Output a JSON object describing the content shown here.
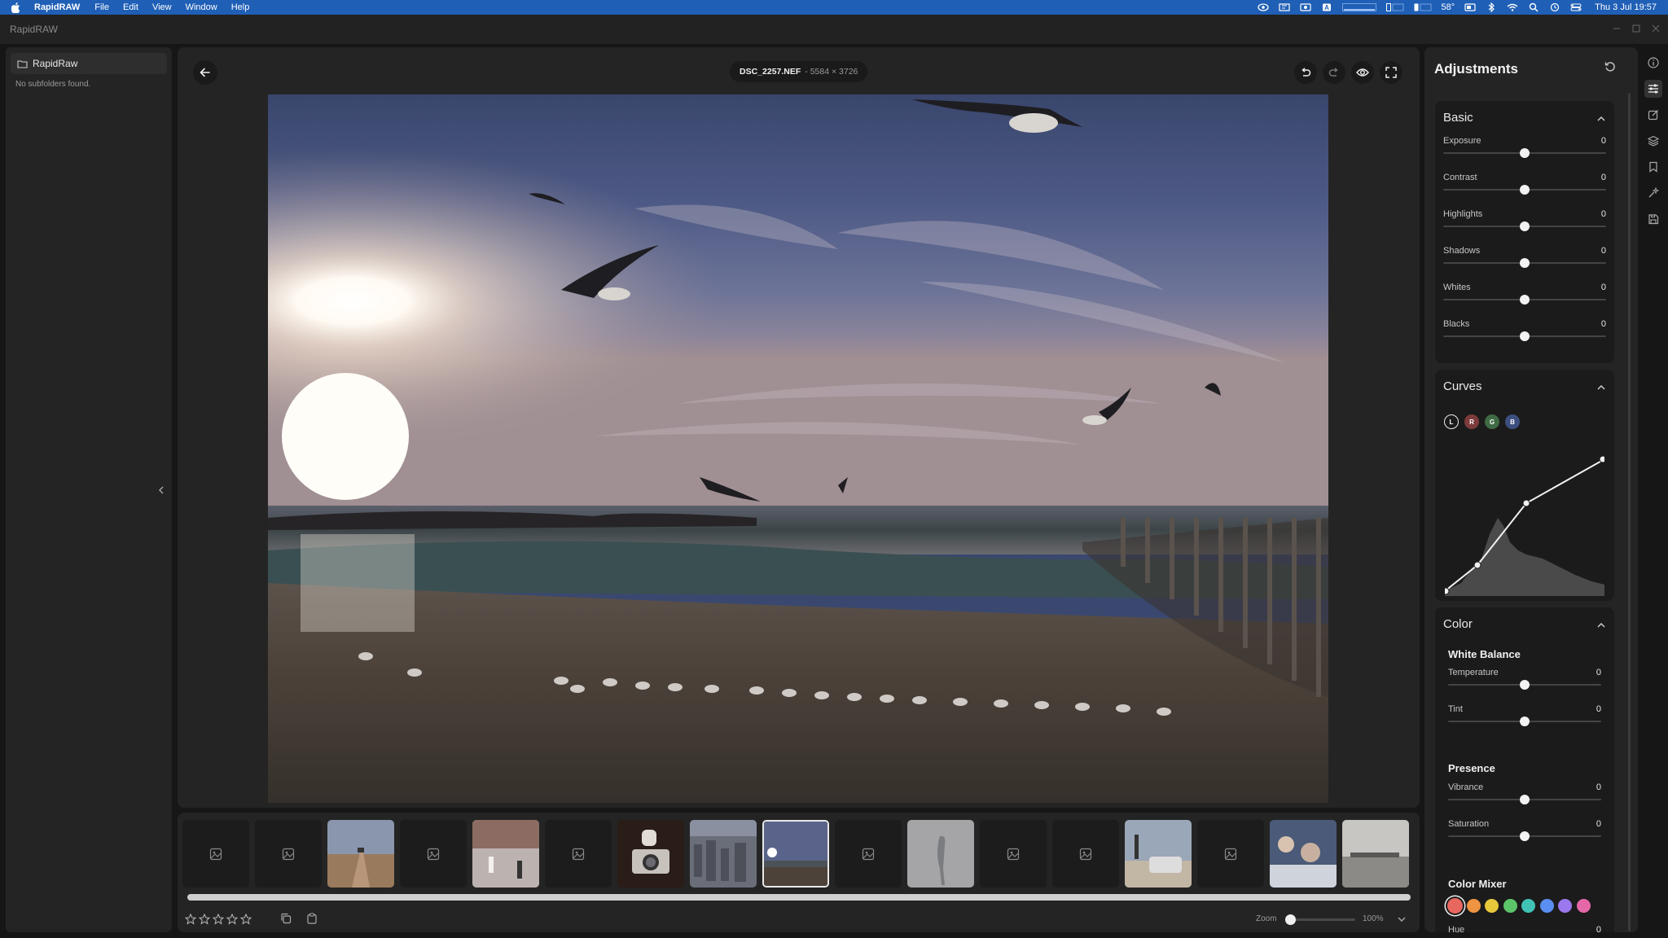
{
  "menubar": {
    "app_name": "RapidRAW",
    "menus": [
      "File",
      "Edit",
      "View",
      "Window",
      "Help"
    ],
    "temperature": "58°",
    "clock": "Thu 3 Jul  19:57"
  },
  "window": {
    "title": "RapidRAW"
  },
  "folders": {
    "root_label": "RapidRaw",
    "empty_message": "No subfolders found."
  },
  "editor": {
    "file_name": "DSC_2257.NEF",
    "dimensions": "- 5584 × 3726"
  },
  "filmstrip": {
    "zoom_label": "Zoom",
    "zoom_value": "100%",
    "zoom_fraction": 0.0,
    "rating_stars": 5
  },
  "adjustments": {
    "title": "Adjustments",
    "basic": {
      "title": "Basic",
      "sliders": [
        {
          "label": "Exposure",
          "value": "0"
        },
        {
          "label": "Contrast",
          "value": "0"
        },
        {
          "label": "Highlights",
          "value": "0"
        },
        {
          "label": "Shadows",
          "value": "0"
        },
        {
          "label": "Whites",
          "value": "0"
        },
        {
          "label": "Blacks",
          "value": "0"
        }
      ]
    },
    "curves": {
      "title": "Curves",
      "channels": [
        "L",
        "R",
        "G",
        "B"
      ]
    },
    "color": {
      "title": "Color",
      "white_balance": "White Balance",
      "wb_sliders": [
        {
          "label": "Temperature",
          "value": "0"
        },
        {
          "label": "Tint",
          "value": "0"
        }
      ],
      "presence": "Presence",
      "presence_sliders": [
        {
          "label": "Vibrance",
          "value": "0"
        },
        {
          "label": "Saturation",
          "value": "0"
        }
      ],
      "color_mixer": "Color Mixer",
      "swatches": [
        "#e8675f",
        "#ef9442",
        "#e7c83a",
        "#5cc56a",
        "#40c3b5",
        "#5a8ef0",
        "#9b78ee",
        "#e467a8"
      ],
      "hue_label": "Hue",
      "hue_value": "0"
    }
  },
  "colors": {
    "menubar_blue": "#1f5fb6",
    "panel_bg": "#242424",
    "section_bg": "#1b1b1b"
  }
}
